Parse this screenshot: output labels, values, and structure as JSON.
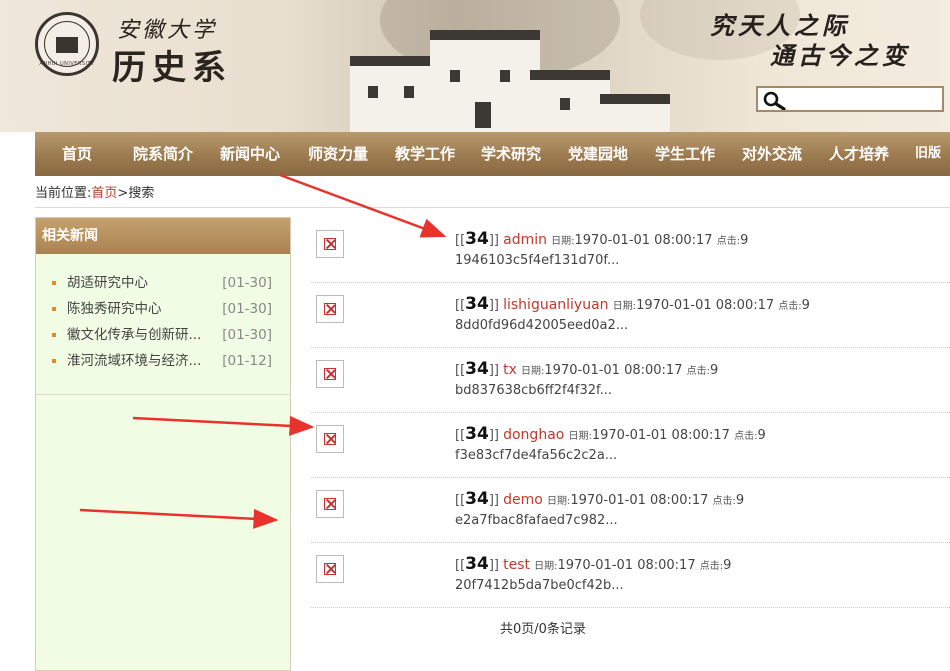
{
  "header": {
    "school_name": "安徽大学",
    "dept_name": "历史系",
    "emblem_ring": "ANHUI UNIVERSITY",
    "motto_line1": "究天人之际",
    "motto_line2": "通古今之变",
    "search": {
      "value": "",
      "placeholder": "",
      "icon": "search-icon"
    }
  },
  "nav": [
    "首页",
    "院系简介",
    "新闻中心",
    "师资力量",
    "教学工作",
    "学术研究",
    "党建园地",
    "学生工作",
    "对外交流",
    "人才培养",
    "旧版"
  ],
  "breadcrumb": {
    "prefix": "当前位置:",
    "home": "首页",
    "sep": ">",
    "current": "搜索"
  },
  "sidebar": {
    "title": "相关新闻",
    "items": [
      {
        "label": "胡适研究中心",
        "date": "[01-30]"
      },
      {
        "label": "陈独秀研究中心",
        "date": "[01-30]"
      },
      {
        "label": "徽文化传承与创新研...",
        "date": "[01-30]"
      },
      {
        "label": "淮河流域环境与经济...",
        "date": "[01-12]"
      }
    ]
  },
  "results": {
    "date_label": "日期:",
    "click_label": "点击:",
    "items": [
      {
        "id": "34",
        "title": "admin",
        "date": "1970-01-01 08:00:17",
        "clicks": "9",
        "hash": "1946103c5f4ef131d70f..."
      },
      {
        "id": "34",
        "title": "lishiguanliyuan",
        "date": "1970-01-01 08:00:17",
        "clicks": "9",
        "hash": "8dd0fd96d42005eed0a2..."
      },
      {
        "id": "34",
        "title": "tx",
        "date": "1970-01-01 08:00:17",
        "clicks": "9",
        "hash": "bd837638cb6ff2f4f32f..."
      },
      {
        "id": "34",
        "title": "donghao",
        "date": "1970-01-01 08:00:17",
        "clicks": "9",
        "hash": "f3e83cf7de4fa56c2c2a..."
      },
      {
        "id": "34",
        "title": "demo",
        "date": "1970-01-01 08:00:17",
        "clicks": "9",
        "hash": "e2a7fbac8fafaed7c982..."
      },
      {
        "id": "34",
        "title": "test",
        "date": "1970-01-01 08:00:17",
        "clicks": "9",
        "hash": "20f7412b5da7be0cf42b..."
      }
    ],
    "pager": "共0页/0条记录"
  },
  "colors": {
    "accent_red": "#c0392b",
    "nav_brown": "#9c7a4f",
    "sidebar_bg": "#f0fce4",
    "arrow_red": "#e8322b"
  }
}
